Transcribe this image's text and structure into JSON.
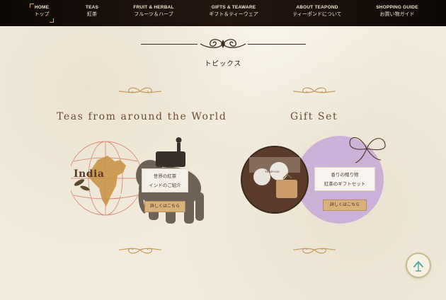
{
  "nav": {
    "items": [
      {
        "en": "HOME",
        "ja": "トップ"
      },
      {
        "en": "TEAS",
        "ja": "紅茶"
      },
      {
        "en": "FRUIT & HERBAL",
        "ja": "フルーツ＆ハーブ"
      },
      {
        "en": "GIFTS & TEAWARE",
        "ja": "ギフト＆ティーウェア"
      },
      {
        "en": "ABOUT TEAPOND",
        "ja": "ティーポンドについて"
      },
      {
        "en": "SHOPPING GUIDE",
        "ja": "お買い物ガイド"
      }
    ]
  },
  "section": {
    "title": "トピックス"
  },
  "cards": [
    {
      "title": "Teas from around the World",
      "map_label": "India",
      "info_line1": "世界の紅茶",
      "info_line2": "インドのご紹介",
      "button": "詳しくはこちら"
    },
    {
      "title": "Gift Set",
      "box_label": "TEAPOND",
      "info_line1": "香りの贈り物",
      "info_line2": "紅茶のギフトセット",
      "button": "詳しくはこちら"
    }
  ],
  "colors": {
    "nav_bg": "#1a100b",
    "nav_text": "#f1e6d2",
    "accent_gold": "#d8a25a",
    "title_brown": "#6b4a33",
    "button_bg": "#d9b27b",
    "background": "#f3ecdd",
    "lavender": "#c6a8d8"
  },
  "icons": {
    "scroll_top": "chevron-up-icon"
  }
}
